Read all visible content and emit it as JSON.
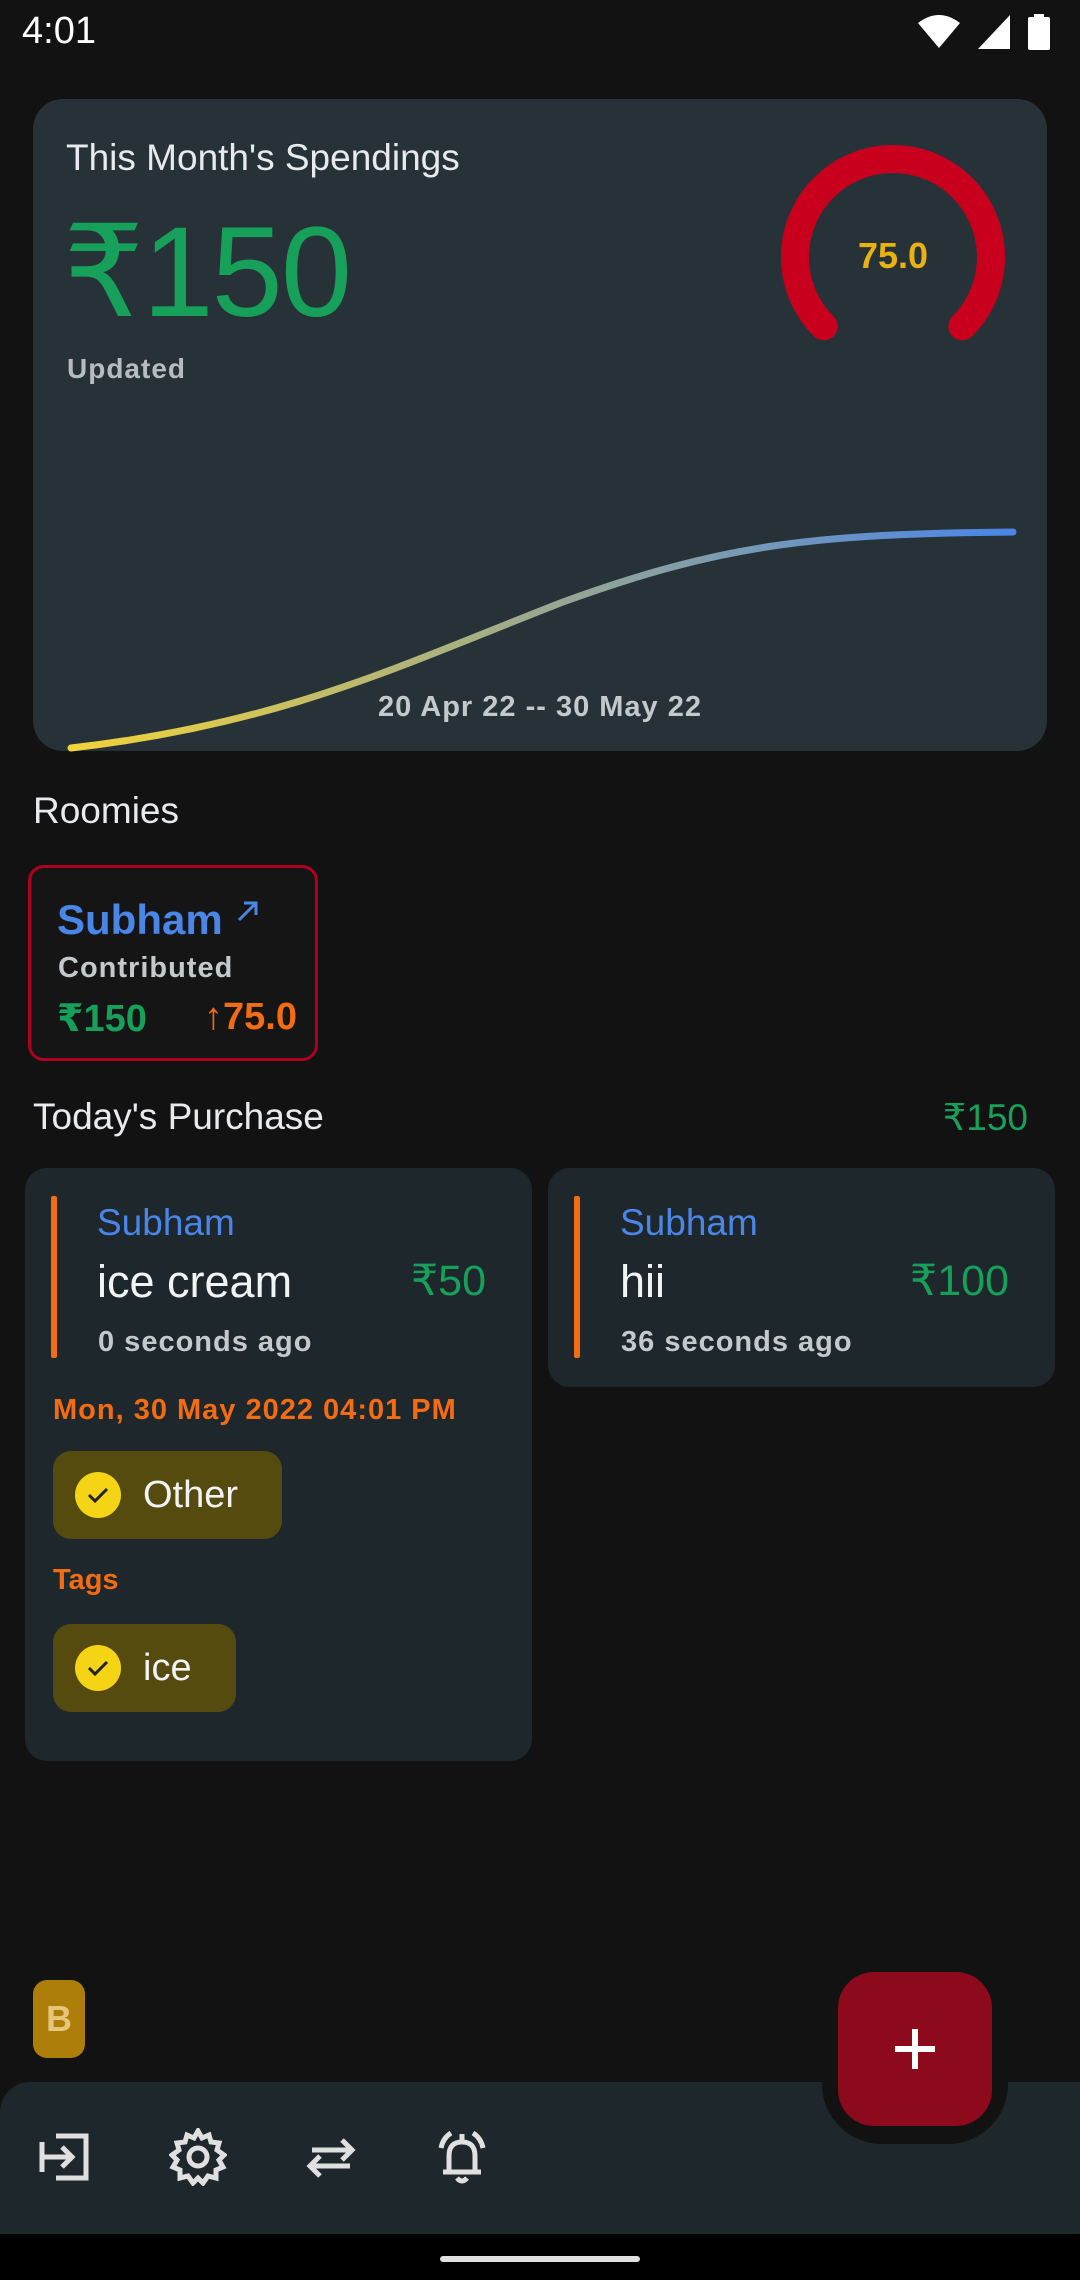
{
  "status_bar": {
    "time": "4:01"
  },
  "spendings": {
    "title": "This Month's Spendings",
    "amount": "₹150",
    "updated_label": "Updated",
    "gauge_value": "75.0",
    "gauge_fraction": 0.75,
    "date_range": "20 Apr 22 -- 30 May 22",
    "colors": {
      "amount": "#16a05a",
      "gauge": "#c8001e",
      "gauge_text": "#e9b213",
      "curve_start": "#f2d43a",
      "curve_end": "#4a86e8"
    }
  },
  "roomies": {
    "title": "Roomies",
    "items": [
      {
        "name": "Subham",
        "contrib_label": "Contributed",
        "amount": "₹150",
        "percent": "↑75.0"
      }
    ]
  },
  "today": {
    "title": "Today's Purchase",
    "total": "₹150",
    "purchases": [
      {
        "user": "Subham",
        "item": "ice cream",
        "price": "₹50",
        "time_ago": "0 seconds ago",
        "date": "Mon, 30 May 2022 04:01 PM",
        "category": "Other",
        "tags_label": "Tags",
        "tags": [
          "ice"
        ]
      },
      {
        "user": "Subham",
        "item": "hii",
        "price": "₹100",
        "time_ago": "36 seconds ago"
      }
    ]
  },
  "avatar": {
    "letter": "B"
  },
  "bottom_nav": {
    "icons": [
      "logout-icon",
      "settings-icon",
      "swap-icon",
      "notification-icon"
    ],
    "fab_icon": "plus-icon"
  }
}
